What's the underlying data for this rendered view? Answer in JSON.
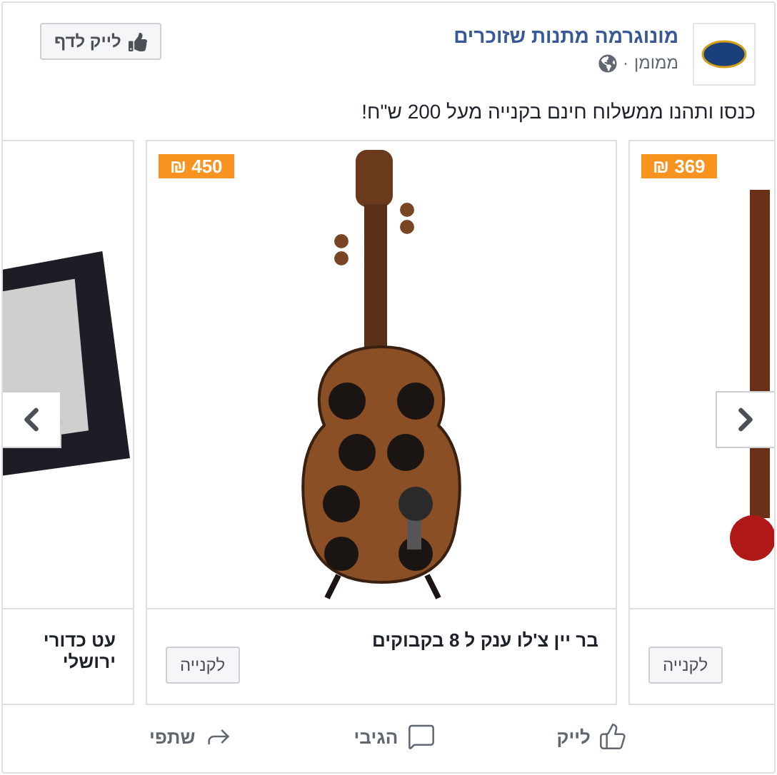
{
  "page": {
    "name": "מונוגרמה מתנות שזוכרים",
    "sponsored": "ממומן",
    "separator": "·",
    "like_button": "לייק לדף"
  },
  "message": "כנסו ותהנו ממשלוח חינם בקנייה מעל 200 ש\"ח!",
  "carousel": [
    {
      "kind": "wine-rack",
      "price": "₪ 369",
      "button": "לקנייה"
    },
    {
      "kind": "violin",
      "price": "₪ 450",
      "title": "בר יין צ'לו ענק ל 8 בקבוקים",
      "button": "לקנייה"
    },
    {
      "kind": "pen-box",
      "title": "עט כדורי ירושלי"
    }
  ],
  "actions": [
    {
      "kind": "like",
      "label": "לייק"
    },
    {
      "kind": "comment",
      "label": "הגיבי"
    },
    {
      "kind": "share",
      "label": "שתפי"
    }
  ]
}
